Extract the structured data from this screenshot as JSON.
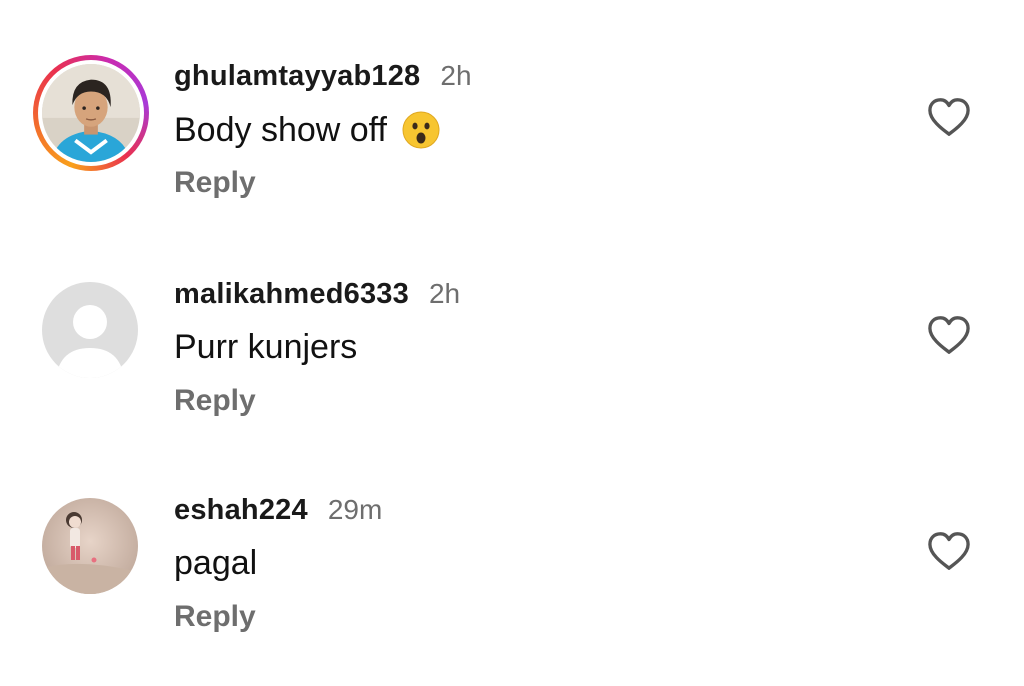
{
  "comments": [
    {
      "username": "ghulamtayyab128",
      "time": "2h",
      "text": "Body show off",
      "emoji": "😮",
      "reply_label": "Reply",
      "has_story_ring": true
    },
    {
      "username": "malikahmed6333",
      "time": "2h",
      "text": "Purr kunjers",
      "reply_label": "Reply",
      "has_story_ring": false
    },
    {
      "username": "eshah224",
      "time": "29m",
      "text": "pagal",
      "reply_label": "Reply",
      "has_story_ring": false
    }
  ],
  "icons": {
    "like": "heart-outline-icon",
    "reaction": "astonished-face-emoji"
  },
  "colors": {
    "username": "#1a1a1a",
    "secondary": "#6e6e6e",
    "ring_start": "#f9a01b",
    "ring_end": "#c92bb2"
  }
}
